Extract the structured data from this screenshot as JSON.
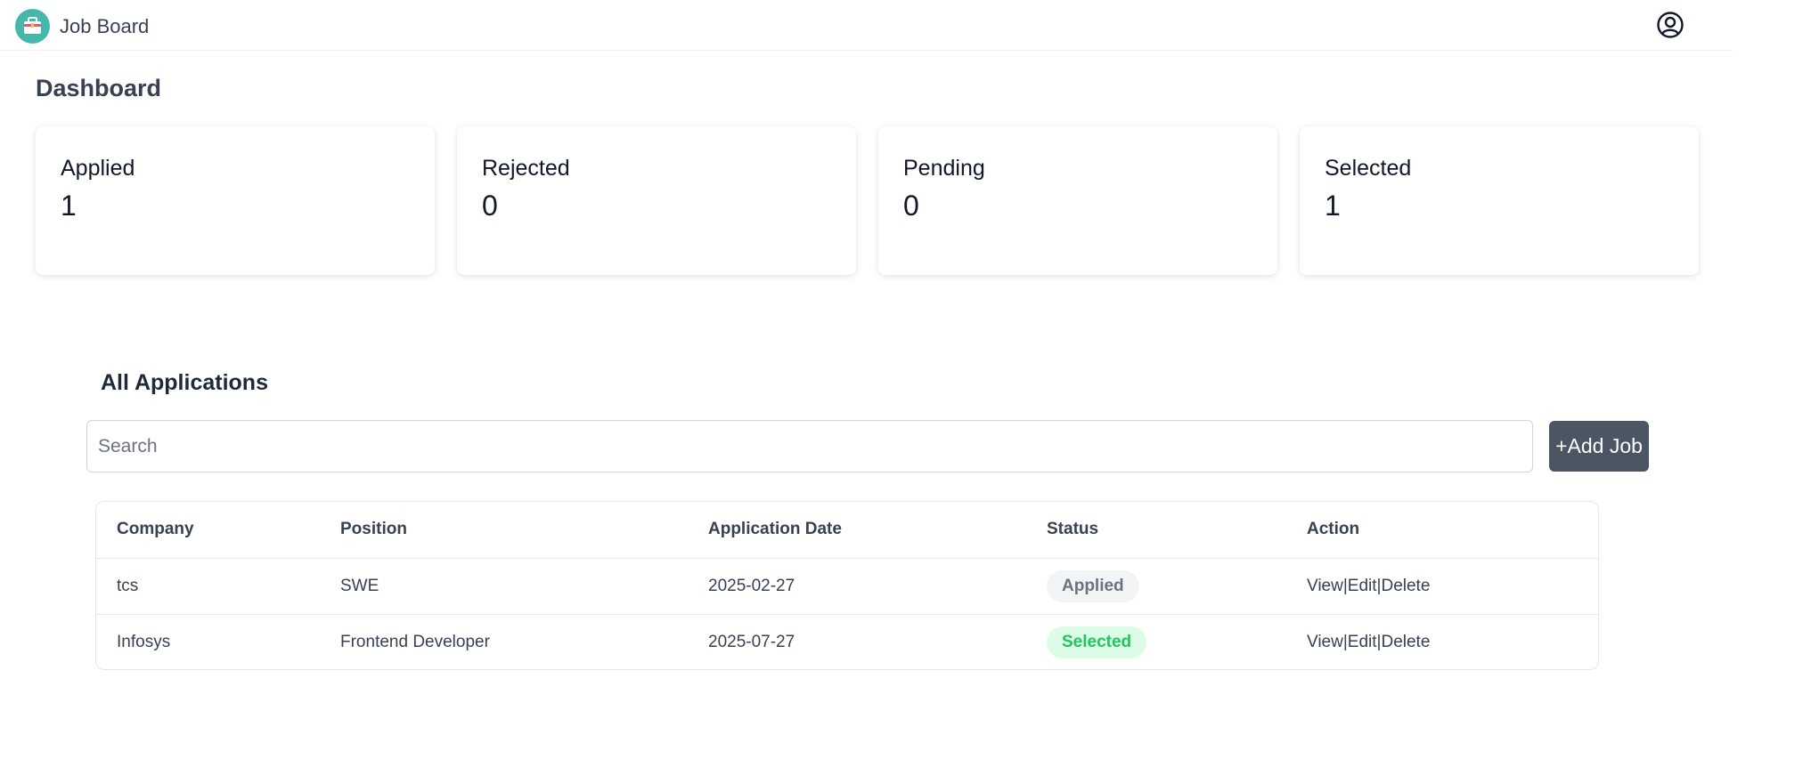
{
  "app": {
    "name": "Job Board"
  },
  "header": {
    "icons": [
      "briefcase-icon",
      "user-circle-icon"
    ]
  },
  "dashboard": {
    "title": "Dashboard",
    "stats": [
      {
        "label": "Applied",
        "value": "1"
      },
      {
        "label": "Rejected",
        "value": "0"
      },
      {
        "label": "Pending",
        "value": "0"
      },
      {
        "label": "Selected",
        "value": "1"
      }
    ]
  },
  "applications": {
    "title": "All Applications",
    "search_placeholder": "Search",
    "search_value": "",
    "add_button_label": "+Add Job",
    "columns": [
      "Company",
      "Position",
      "Application Date",
      "Status",
      "Action"
    ],
    "rows": [
      {
        "company": "tcs",
        "position": "SWE",
        "date": "2025-02-27",
        "status": "Applied",
        "actions": {
          "view": "View",
          "edit": "Edit",
          "delete": "Delete",
          "separator": "|"
        }
      },
      {
        "company": "Infosys",
        "position": "Frontend Developer",
        "date": "2025-07-27",
        "status": "Selected",
        "actions": {
          "view": "View",
          "edit": "Edit",
          "delete": "Delete",
          "separator": "|"
        }
      }
    ]
  },
  "colors": {
    "logo": "#45b8ab",
    "add_button": "#4b5563",
    "badge_applied_bg": "#f3f4f6",
    "badge_applied_text": "#6b7280",
    "badge_selected_bg": "#dcfce7",
    "badge_selected_text": "#22c55e"
  }
}
